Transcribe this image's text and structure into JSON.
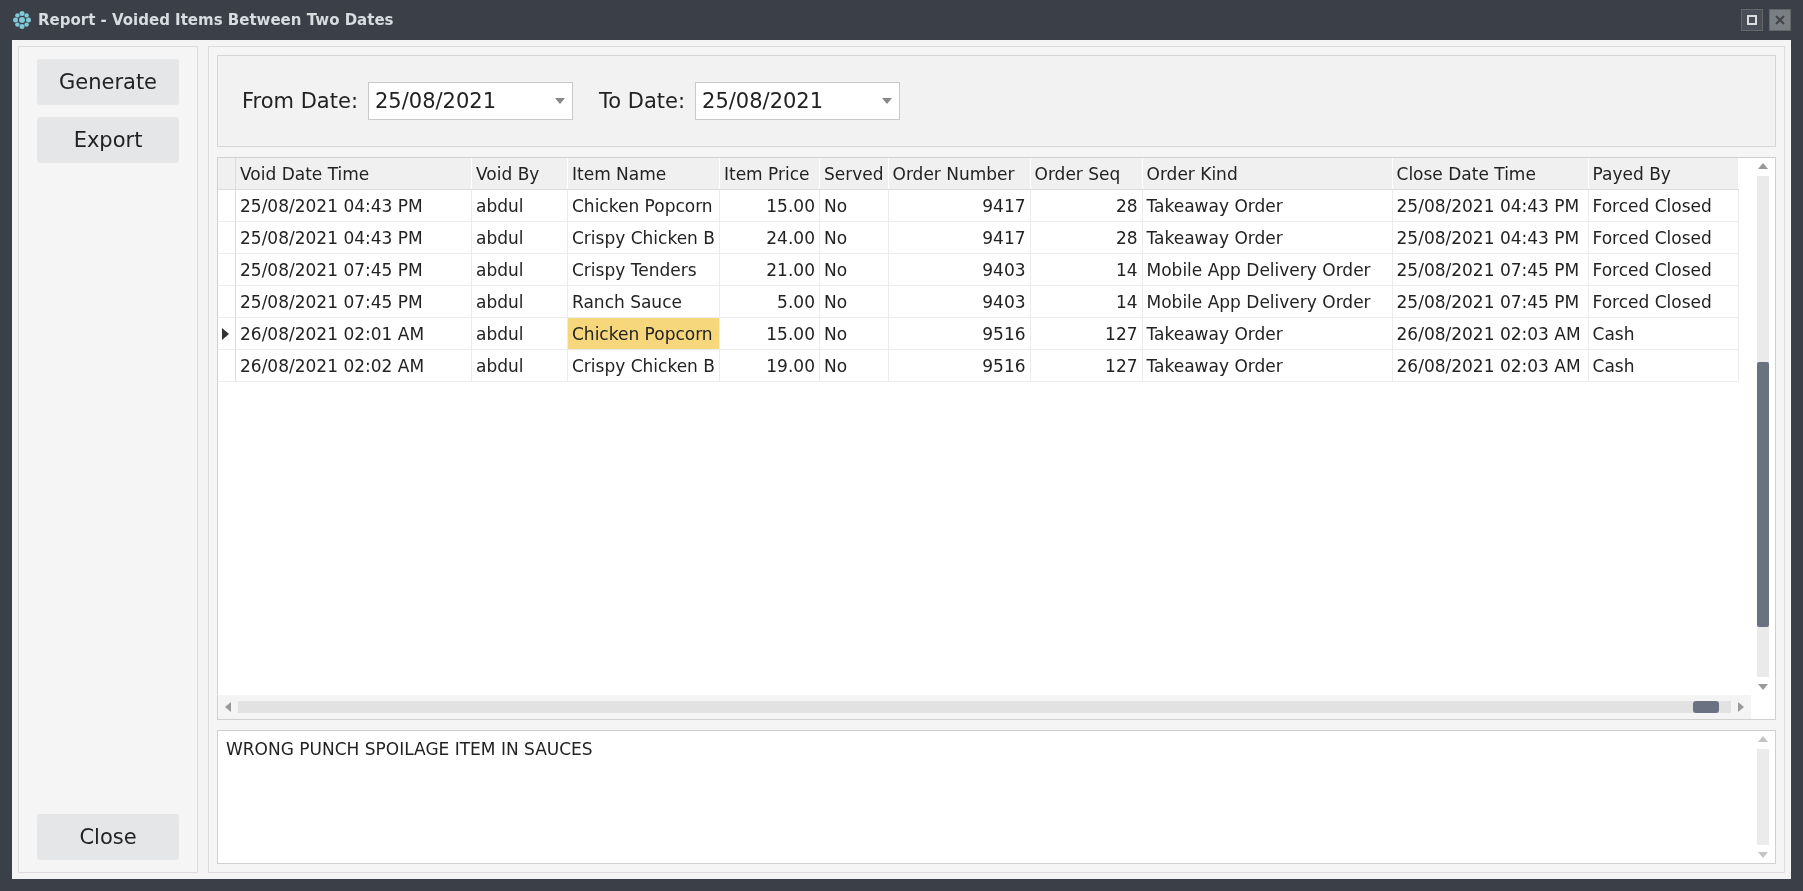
{
  "window": {
    "title": "Report - Voided Items Between Two Dates"
  },
  "sidebar": {
    "buttons": [
      {
        "label": "Generate",
        "kind": "top"
      },
      {
        "label": "Export",
        "kind": "top"
      },
      {
        "label": "Close",
        "kind": "bottom"
      }
    ]
  },
  "filters": [
    {
      "label": "From Date:",
      "value": "25/08/2021"
    },
    {
      "label": "To Date:",
      "value": "25/08/2021"
    }
  ],
  "table": {
    "columns": [
      {
        "label": "Void Date Time",
        "kind": "text"
      },
      {
        "label": "Void By",
        "kind": "text"
      },
      {
        "label": "Item Name",
        "kind": "text"
      },
      {
        "label": "Item Price",
        "kind": "number"
      },
      {
        "label": "Served",
        "kind": "text"
      },
      {
        "label": "Order Number",
        "kind": "number"
      },
      {
        "label": "Order Seq",
        "kind": "number"
      },
      {
        "label": "Order Kind",
        "kind": "text"
      },
      {
        "label": "Close Date Time",
        "kind": "text"
      },
      {
        "label": "Payed By",
        "kind": "text"
      }
    ],
    "rows": [
      {
        "selected": false,
        "cells": [
          {
            "text": "25/08/2021 04:43 PM",
            "focused": false
          },
          {
            "text": "abdul",
            "focused": false
          },
          {
            "text": "Chicken Popcorn",
            "focused": false
          },
          {
            "text": "15.00",
            "focused": false
          },
          {
            "text": "No",
            "focused": false
          },
          {
            "text": "9417",
            "focused": false
          },
          {
            "text": "28",
            "focused": false
          },
          {
            "text": "Takeaway Order",
            "focused": false
          },
          {
            "text": "25/08/2021 04:43 PM",
            "focused": false
          },
          {
            "text": "Forced Closed",
            "focused": false
          }
        ]
      },
      {
        "selected": false,
        "cells": [
          {
            "text": "25/08/2021 04:43 PM",
            "focused": false
          },
          {
            "text": "abdul",
            "focused": false
          },
          {
            "text": "Crispy Chicken B",
            "focused": false
          },
          {
            "text": "24.00",
            "focused": false
          },
          {
            "text": "No",
            "focused": false
          },
          {
            "text": "9417",
            "focused": false
          },
          {
            "text": "28",
            "focused": false
          },
          {
            "text": "Takeaway Order",
            "focused": false
          },
          {
            "text": "25/08/2021 04:43 PM",
            "focused": false
          },
          {
            "text": "Forced Closed",
            "focused": false
          }
        ]
      },
      {
        "selected": false,
        "cells": [
          {
            "text": "25/08/2021 07:45 PM",
            "focused": false
          },
          {
            "text": "abdul",
            "focused": false
          },
          {
            "text": "Crispy Tenders",
            "focused": false
          },
          {
            "text": "21.00",
            "focused": false
          },
          {
            "text": "No",
            "focused": false
          },
          {
            "text": "9403",
            "focused": false
          },
          {
            "text": "14",
            "focused": false
          },
          {
            "text": "Mobile App Delivery Order",
            "focused": false
          },
          {
            "text": "25/08/2021 07:45 PM",
            "focused": false
          },
          {
            "text": "Forced Closed",
            "focused": false
          }
        ]
      },
      {
        "selected": false,
        "cells": [
          {
            "text": "25/08/2021 07:45 PM",
            "focused": false
          },
          {
            "text": "abdul",
            "focused": false
          },
          {
            "text": "Ranch Sauce",
            "focused": false
          },
          {
            "text": "5.00",
            "focused": false
          },
          {
            "text": "No",
            "focused": false
          },
          {
            "text": "9403",
            "focused": false
          },
          {
            "text": "14",
            "focused": false
          },
          {
            "text": "Mobile App Delivery Order",
            "focused": false
          },
          {
            "text": "25/08/2021 07:45 PM",
            "focused": false
          },
          {
            "text": "Forced Closed",
            "focused": false
          }
        ]
      },
      {
        "selected": true,
        "cells": [
          {
            "text": "26/08/2021 02:01 AM",
            "focused": false
          },
          {
            "text": "abdul",
            "focused": false
          },
          {
            "text": "Chicken Popcorn",
            "focused": true
          },
          {
            "text": "15.00",
            "focused": false
          },
          {
            "text": "No",
            "focused": false
          },
          {
            "text": "9516",
            "focused": false
          },
          {
            "text": "127",
            "focused": false
          },
          {
            "text": "Takeaway Order",
            "focused": false
          },
          {
            "text": "26/08/2021 02:03 AM",
            "focused": false
          },
          {
            "text": "Cash",
            "focused": false
          }
        ]
      },
      {
        "selected": false,
        "cells": [
          {
            "text": "26/08/2021 02:02 AM",
            "focused": false
          },
          {
            "text": "abdul",
            "focused": false
          },
          {
            "text": "Crispy Chicken B",
            "focused": false
          },
          {
            "text": "19.00",
            "focused": false
          },
          {
            "text": "No",
            "focused": false
          },
          {
            "text": "9516",
            "focused": false
          },
          {
            "text": "127",
            "focused": false
          },
          {
            "text": "Takeaway Order",
            "focused": false
          },
          {
            "text": "26/08/2021 02:03 AM",
            "focused": false
          },
          {
            "text": "Cash",
            "focused": false
          }
        ]
      }
    ]
  },
  "notes": {
    "text": "WRONG PUNCH SPOILAGE ITEM IN SAUCES"
  }
}
